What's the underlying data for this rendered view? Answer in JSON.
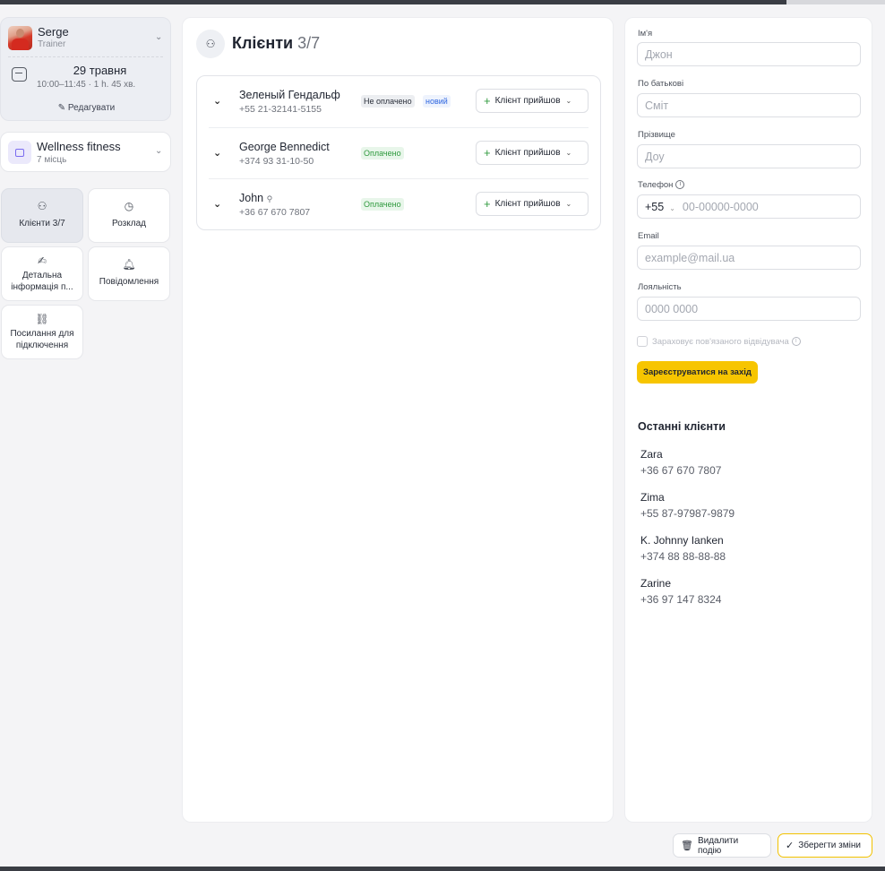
{
  "trainer": {
    "name": "Serge",
    "role": "Trainer"
  },
  "event": {
    "date": "29 травня",
    "time": "10:00–11:45 · 1 h. 45 хв.",
    "edit_label": "Редагувати"
  },
  "gym": {
    "name": "Wellness fitness",
    "capacity": "7 місць"
  },
  "tiles": [
    {
      "label": "Клієнти 3/7",
      "icon": "users-icon"
    },
    {
      "label": "Розклад",
      "icon": "clock-icon"
    },
    {
      "label": "Детальна інформація п...",
      "icon": "edit-doc-icon"
    },
    {
      "label": "Повідомлення",
      "icon": "bell-icon"
    },
    {
      "label": "Посилання для підключення",
      "icon": "link-icon"
    }
  ],
  "clients_panel": {
    "title": "Клієнти",
    "count": "3/7"
  },
  "clients": [
    {
      "name": "Зеленый Гендальф",
      "phone": "+55 21-32141-5155",
      "status": "Не оплачено",
      "tag": "новий",
      "action": "Клієнт прийшов"
    },
    {
      "name": "George Bennedict",
      "phone": "+374 93 31-10-50",
      "status": "Оплачено",
      "action": "Клієнт прийшов"
    },
    {
      "name": "John",
      "phone": "+36 67 670 7807",
      "status": "Оплачено",
      "action": "Клієнт прийшов"
    }
  ],
  "form": {
    "first_name": {
      "label": "Ім'я",
      "placeholder": "Джон"
    },
    "middle_name": {
      "label": "По батькові",
      "placeholder": "Сміт"
    },
    "last_name": {
      "label": "Прізвище",
      "placeholder": "Доу"
    },
    "phone": {
      "label": "Телефон",
      "code": "+55",
      "placeholder": "00-00000-0000"
    },
    "email": {
      "label": "Email",
      "placeholder": "example@mail.ua"
    },
    "loyalty": {
      "label": "Лояльність",
      "placeholder": "0000 0000"
    },
    "linked_checkbox": "Зараховує пов'язаного відвідувача",
    "register_label": "Зареєструватися на захід"
  },
  "recent": {
    "title": "Останні клієнти",
    "items": [
      {
        "name": "Zara",
        "phone": "+36 67 670 7807"
      },
      {
        "name": "Zima",
        "phone": "+55 87-97987-9879"
      },
      {
        "name": "K. Johnny Ianken",
        "phone": "+374 88 88-88-88"
      },
      {
        "name": "Zarine",
        "phone": "+36 97 147 8324"
      }
    ]
  },
  "footer": {
    "delete_label": "Видалити подію",
    "save_label": "Зберегти зміни"
  }
}
